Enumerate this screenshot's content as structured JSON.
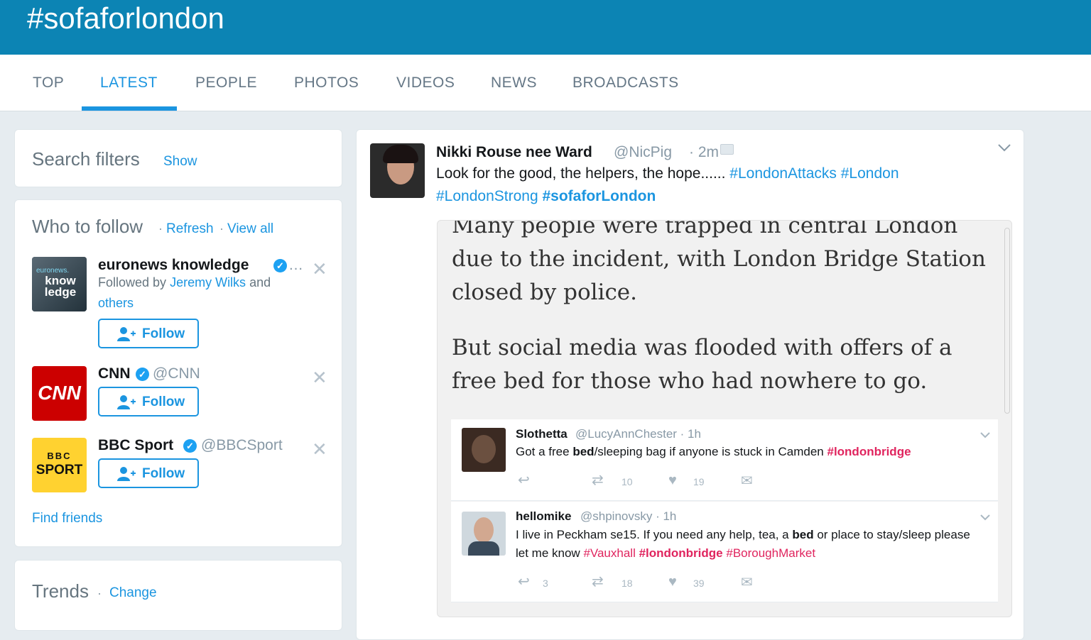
{
  "header": {
    "title": "#sofaforlondon"
  },
  "tabs": [
    {
      "label": "TOP"
    },
    {
      "label": "LATEST"
    },
    {
      "label": "PEOPLE"
    },
    {
      "label": "PHOTOS"
    },
    {
      "label": "VIDEOS"
    },
    {
      "label": "NEWS"
    },
    {
      "label": "BROADCASTS"
    }
  ],
  "search_filters": {
    "title": "Search filters",
    "sep": "·",
    "show_label": "Show"
  },
  "who_to_follow": {
    "title": "Who to follow",
    "sep": "·",
    "refresh_label": "Refresh",
    "view_all_label": "View all",
    "accounts": [
      {
        "name": "euronews knowledge",
        "ellipsis": "…",
        "followed_by_prefix": "Followed by",
        "followed_by_user": "Jeremy Wilks",
        "followed_by_and": "and",
        "followed_by_others": "others",
        "follow_label": "Follow",
        "avatar_text_top": "euronews.",
        "avatar_text": "know ledge"
      },
      {
        "name": "CNN",
        "handle": "@CNN",
        "follow_label": "Follow",
        "avatar_text": "CNN"
      },
      {
        "name": "BBC Sport",
        "handle": "@BBCSport",
        "follow_label": "Follow",
        "avatar_text_top": "BBC",
        "avatar_text": "SPORT"
      }
    ],
    "find_friends_label": "Find friends"
  },
  "trends": {
    "title": "Trends",
    "sep": "·",
    "change_label": "Change"
  },
  "tweet": {
    "name": "Nikki Rouse nee Ward",
    "handle": "@NicPig",
    "time": "· 2m",
    "text_plain": "Look for the good, the helpers, the hope...... ",
    "hashtag1": "#LondonAttacks",
    "hashtag2": "#London",
    "hashtag3": "#LondonStrong",
    "hashtag4": "#sofaforLondon",
    "media": {
      "paragraph1": "Many people were trapped in central London due to the incident, with London Bridge Station closed by police.",
      "paragraph2": "But social media was flooded with offers of a free bed for those who had nowhere to go.",
      "embedded_tweets": [
        {
          "name": "Slothetta",
          "meta": "@LucyAnnChester · 1h",
          "text_a": "Got a free ",
          "text_bold": "bed",
          "text_b": "/sleeping bag if anyone is stuck in Camden ",
          "tag1": "#londonbridge",
          "retweets": "10",
          "likes": "19"
        },
        {
          "name": "hellomike",
          "meta": "@shpinovsky · 1h",
          "text_a": "I live in Peckham se15. If you need any help, tea, a ",
          "text_bold": "bed",
          "text_b": " or place to stay/sleep please let me know ",
          "tag1": "#Vauxhall",
          "tag2": "#londonbridge",
          "tag3": "#BoroughMarket",
          "replies": "3",
          "retweets": "18",
          "likes": "39"
        }
      ]
    }
  }
}
